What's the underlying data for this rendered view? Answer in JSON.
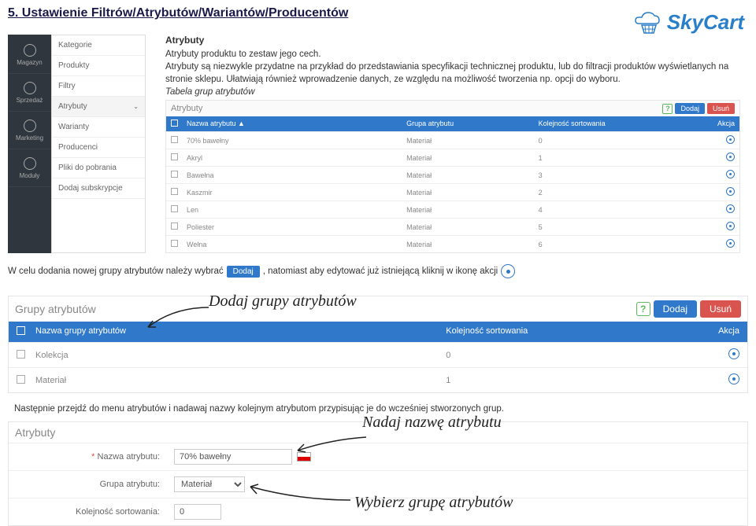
{
  "page_title": "5. Ustawienie Filtrów/Atrybutów/Wariantów/Producentów",
  "logo_text": "SkyCart",
  "sidebar": {
    "items": [
      {
        "label": "Magazyn"
      },
      {
        "label": "Sprzedaż"
      },
      {
        "label": "Marketing"
      },
      {
        "label": "Moduły"
      }
    ]
  },
  "submenu": {
    "items": [
      {
        "label": "Kategorie"
      },
      {
        "label": "Produkty"
      },
      {
        "label": "Filtry"
      },
      {
        "label": "Atrybuty",
        "active": true
      },
      {
        "label": "Warianty"
      },
      {
        "label": "Producenci"
      },
      {
        "label": "Pliki do pobrania"
      },
      {
        "label": "Dodaj subskrypcje"
      }
    ]
  },
  "text": {
    "heading": "Atrybuty",
    "line1": "Atrybuty produktu to zestaw jego cech.",
    "body": "Atrybuty są niezwykle przydatne na przykład do przedstawiania specyfikacji technicznej produktu, lub do filtracji produktów wyświetlanych na stronie sklepu. Ułatwiają również wprowadzenie danych, ze względu na możliwość tworzenia np. opcji do wyboru.",
    "table_caption": "Tabela grup atrybutów"
  },
  "attr_table": {
    "title": "Atrybuty",
    "add": "Dodaj",
    "del": "Usuń",
    "headers": {
      "c2": "Nazwa atrybutu ▲",
      "c3": "Grupa atrybutu",
      "c4": "Kolejność sortowania",
      "c5": "Akcja"
    },
    "rows": [
      {
        "name": "70% bawełny",
        "group": "Materiał",
        "sort": "0"
      },
      {
        "name": "Akryl",
        "group": "Materiał",
        "sort": "1"
      },
      {
        "name": "Bawełna",
        "group": "Materiał",
        "sort": "3"
      },
      {
        "name": "Kaszmir",
        "group": "Materiał",
        "sort": "2"
      },
      {
        "name": "Len",
        "group": "Materiał",
        "sort": "4"
      },
      {
        "name": "Poliester",
        "group": "Materiał",
        "sort": "5"
      },
      {
        "name": "Wełna",
        "group": "Materiał",
        "sort": "6"
      }
    ]
  },
  "caption2": {
    "part1": "W celu dodania nowej grupy atrybutów należy wybrać",
    "btn": "Dodaj",
    "part2": ", natomiast  aby edytować już istniejącą kliknij w ikonę akcji"
  },
  "script1": "Dodaj grupy atrybutów",
  "groups_table": {
    "title": "Grupy atrybutów",
    "add": "Dodaj",
    "del": "Usuń",
    "headers": {
      "c2": "Nazwa grupy atrybutów",
      "c3": "Kolejność sortowania",
      "c4": "Akcja"
    },
    "rows": [
      {
        "name": "Kolekcja",
        "sort": "0"
      },
      {
        "name": "Materiał",
        "sort": "1"
      }
    ]
  },
  "next_text": "Następnie przejdź do menu atrybutów i nadawaj nazwy kolejnym atrybutom przypisując je do wcześniej stworzonych grup.",
  "script2": "Nadaj nazwę atrybutu",
  "script3": "Wybierz grupę atrybutów",
  "form": {
    "title": "Atrybuty",
    "rows": [
      {
        "label": "Nazwa atrybutu:",
        "required": true,
        "value": "70% bawełny",
        "flag": true
      },
      {
        "label": "Grupa atrybutu:",
        "value": "Materiał",
        "select": true
      },
      {
        "label": "Kolejność sortowania:",
        "value": "0",
        "small": true
      }
    ]
  }
}
